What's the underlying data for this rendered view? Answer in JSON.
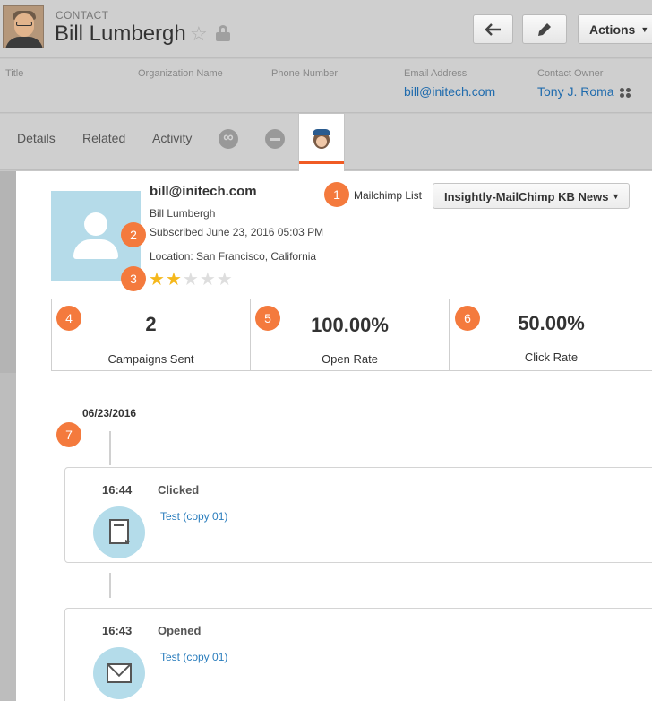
{
  "header": {
    "record_type": "CONTACT",
    "name": "Bill Lumbergh",
    "star": "☆",
    "actions_label": "Actions"
  },
  "fields": [
    {
      "label": "Title",
      "value": ""
    },
    {
      "label": "Organization Name",
      "value": ""
    },
    {
      "label": "Phone Number",
      "value": ""
    },
    {
      "label": "Email Address",
      "value": "bill@initech.com"
    },
    {
      "label": "Contact Owner",
      "value": "Tony J. Roma"
    }
  ],
  "tabs": [
    "Details",
    "Related",
    "Activity"
  ],
  "profile": {
    "email": "bill@initech.com",
    "name": "Bill Lumbergh",
    "subscribed": "Subscribed June 23, 2016 05:03 PM",
    "location": "Location: San Francisco, California",
    "rating": 2,
    "max_rating": 5
  },
  "mailchimp": {
    "list_label": "Mailchimp List",
    "selected_list": "Insightly-MailChimp KB News"
  },
  "stats": [
    {
      "value": "2",
      "caption": "Campaigns Sent"
    },
    {
      "value": "100.00%",
      "caption": "Open Rate"
    },
    {
      "value": "50.00%",
      "caption": "Click Rate"
    }
  ],
  "badges": [
    "1",
    "2",
    "3",
    "4",
    "5",
    "6",
    "7"
  ],
  "timeline": {
    "date": "06/23/2016",
    "events": [
      {
        "time": "16:44",
        "type": "Clicked",
        "link": "Test (copy 01)",
        "icon": "document-icon"
      },
      {
        "time": "16:43",
        "type": "Opened",
        "link": "Test (copy 01)",
        "icon": "envelope-icon"
      }
    ]
  },
  "colors": {
    "accent": "#f05b24",
    "badge": "#f47a3d",
    "link": "#1f6bad",
    "star_on": "#f5b81c",
    "icon_circle": "#b4dcea"
  }
}
